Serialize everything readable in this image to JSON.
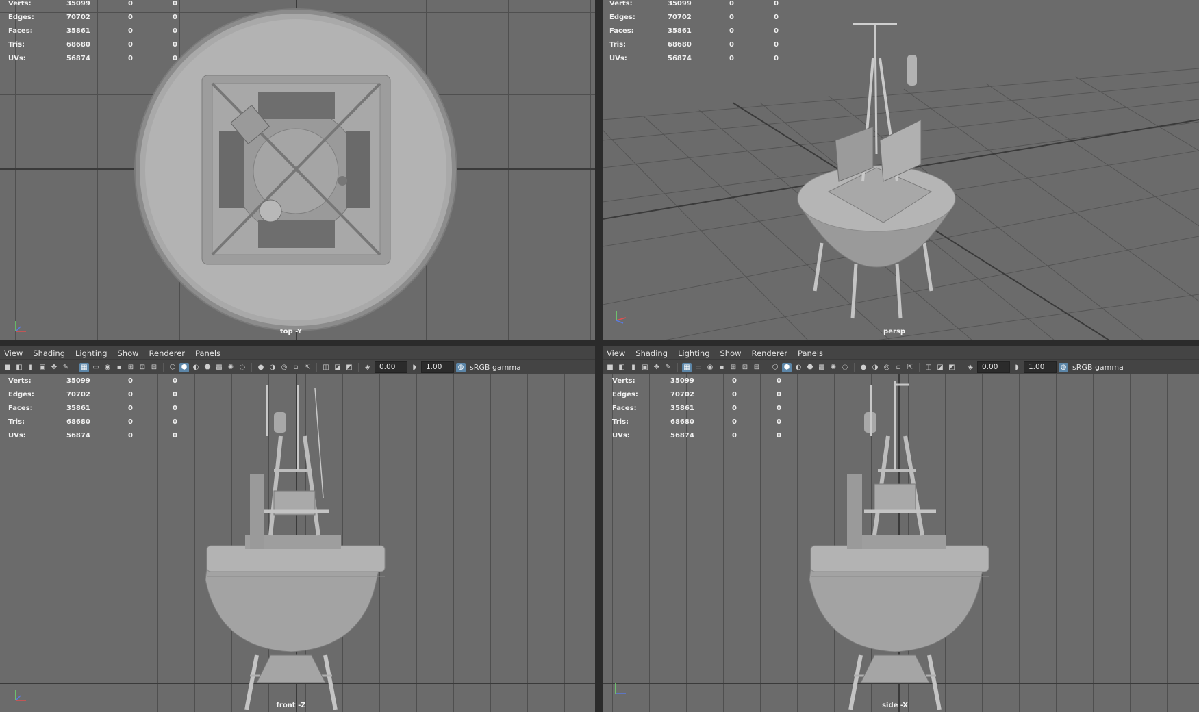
{
  "menu": [
    "View",
    "Shading",
    "Lighting",
    "Show",
    "Renderer",
    "Panels"
  ],
  "toolbar": {
    "exposure_value": "0.00",
    "gamma_value": "1.00",
    "color_space": "sRGB gamma"
  },
  "hud": {
    "rows": [
      {
        "label": "Verts:",
        "total": "35099",
        "selected": "0",
        "comp": "0"
      },
      {
        "label": "Edges:",
        "total": "70702",
        "selected": "0",
        "comp": "0"
      },
      {
        "label": "Faces:",
        "total": "35861",
        "selected": "0",
        "comp": "0"
      },
      {
        "label": "Tris:",
        "total": "68680",
        "selected": "0",
        "comp": "0"
      },
      {
        "label": "UVs:",
        "total": "56874",
        "selected": "0",
        "comp": "0"
      }
    ]
  },
  "viewports": {
    "top": {
      "label": "top -Y"
    },
    "persp": {
      "label": "persp"
    },
    "front": {
      "label": "front -Z"
    },
    "side": {
      "label": "side -X"
    }
  },
  "colors": {
    "viewport_bg": "#6b6b6b",
    "grid_line": "#4f4f4f",
    "panel_bg": "#444444",
    "highlight": "#5c86a8"
  }
}
